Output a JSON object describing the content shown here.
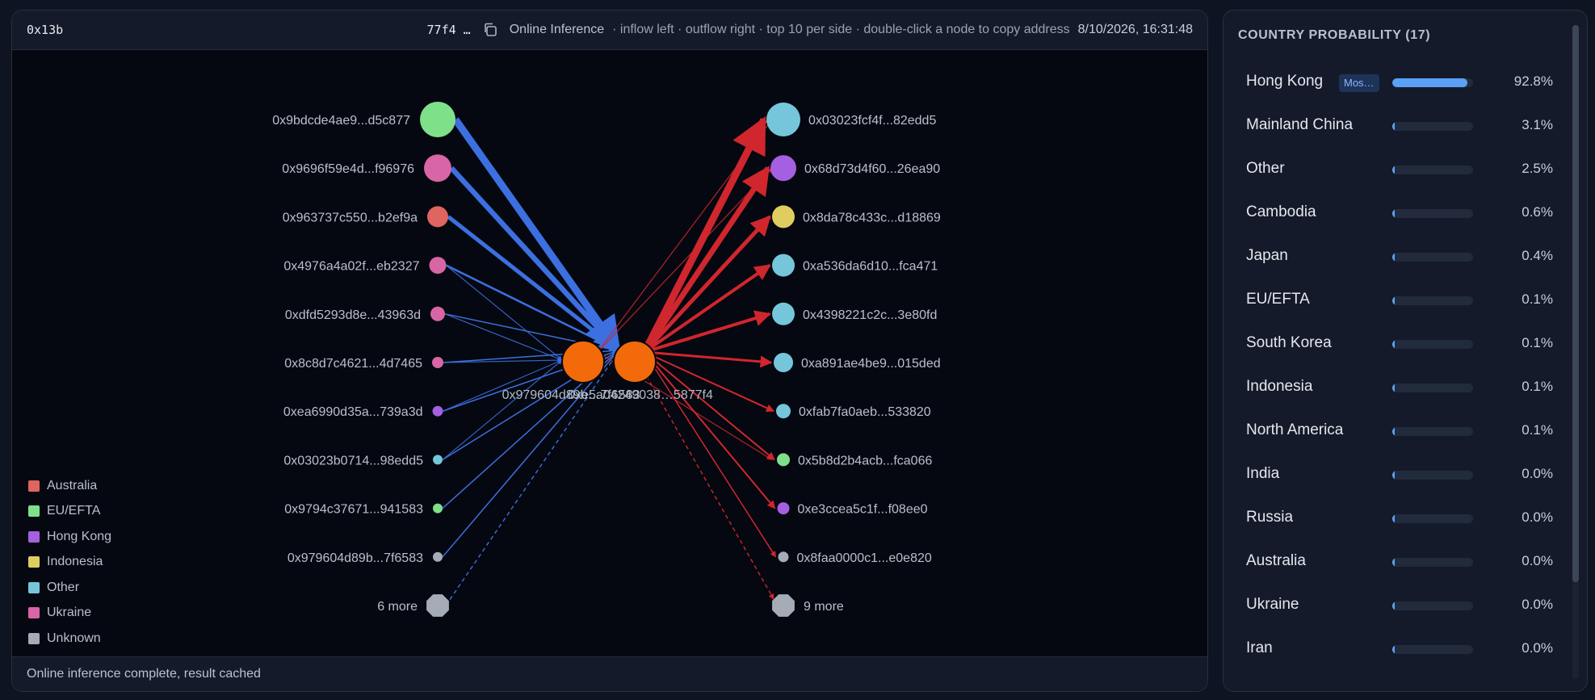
{
  "header": {
    "node_id": "0x13b",
    "address_short": "77f4 …",
    "mode": "Online Inference",
    "hint": "· inflow left · outflow right · top 10 per side · double-click a node to copy address",
    "timestamp": "8/10/2026, 16:31:48"
  },
  "colors": {
    "Australia": "#e0645f",
    "EU/EFTA": "#7fe08a",
    "Hong Kong": "#a460e0",
    "Indonesia": "#e0cd62",
    "Other": "#75c6db",
    "Ukraine": "#d865a6",
    "Unknown": "#a6acb7",
    "center": "#f36a0a",
    "inflow": "#3c6fe0",
    "outflow": "#d0262e"
  },
  "graph": {
    "center_labels": [
      "0x979604d89b…7f6583",
      "0xe5a04249038…5877f4"
    ],
    "inflow": [
      {
        "addr": "0x9bdcde4ae9...d5c877",
        "cat": "EU/EFTA"
      },
      {
        "addr": "0x9696f59e4d...f96976",
        "cat": "Ukraine"
      },
      {
        "addr": "0x963737c550...b2ef9a",
        "cat": "Australia"
      },
      {
        "addr": "0x4976a4a02f...eb2327",
        "cat": "Ukraine"
      },
      {
        "addr": "0xdfd5293d8e...43963d",
        "cat": "Ukraine"
      },
      {
        "addr": "0x8c8d7c4621...4d7465",
        "cat": "Ukraine"
      },
      {
        "addr": "0xea6990d35a...739a3d",
        "cat": "Hong Kong"
      },
      {
        "addr": "0x03023b0714...98edd5",
        "cat": "Other"
      },
      {
        "addr": "0x9794c37671...941583",
        "cat": "EU/EFTA"
      },
      {
        "addr": "0x979604d89b...7f6583",
        "cat": "Unknown"
      }
    ],
    "inflow_more": "6 more",
    "outflow": [
      {
        "addr": "0x03023fcf4f...82edd5",
        "cat": "Other"
      },
      {
        "addr": "0x68d73d4f60...26ea90",
        "cat": "Hong Kong"
      },
      {
        "addr": "0x8da78c433c...d18869",
        "cat": "Indonesia"
      },
      {
        "addr": "0xa536da6d10...fca471",
        "cat": "Other"
      },
      {
        "addr": "0x4398221c2c...3e80fd",
        "cat": "Other"
      },
      {
        "addr": "0xa891ae4be9...015ded",
        "cat": "Other"
      },
      {
        "addr": "0xfab7fa0aeb...533820",
        "cat": "Other"
      },
      {
        "addr": "0x5b8d2b4acb...fca066",
        "cat": "EU/EFTA"
      },
      {
        "addr": "0xe3ccea5c1f...f08ee0",
        "cat": "Hong Kong"
      },
      {
        "addr": "0x8faa0000c1...e0e820",
        "cat": "Unknown"
      }
    ],
    "outflow_more": "9 more"
  },
  "legend": [
    "Australia",
    "EU/EFTA",
    "Hong Kong",
    "Indonesia",
    "Other",
    "Ukraine",
    "Unknown"
  ],
  "status": "Online inference complete, result cached",
  "sidebar": {
    "title": "COUNTRY PROBABILITY (17)",
    "badge": "Mos…",
    "items": [
      {
        "name": "Hong Kong",
        "pct": "92.8%",
        "value": 92.8
      },
      {
        "name": "Mainland China",
        "pct": "3.1%",
        "value": 3.1
      },
      {
        "name": "Other",
        "pct": "2.5%",
        "value": 2.5
      },
      {
        "name": "Cambodia",
        "pct": "0.6%",
        "value": 0.6
      },
      {
        "name": "Japan",
        "pct": "0.4%",
        "value": 0.4
      },
      {
        "name": "EU/EFTA",
        "pct": "0.1%",
        "value": 0.1
      },
      {
        "name": "South Korea",
        "pct": "0.1%",
        "value": 0.1
      },
      {
        "name": "Indonesia",
        "pct": "0.1%",
        "value": 0.1
      },
      {
        "name": "North America",
        "pct": "0.1%",
        "value": 0.1
      },
      {
        "name": "India",
        "pct": "0.0%",
        "value": 0.0
      },
      {
        "name": "Russia",
        "pct": "0.0%",
        "value": 0.0
      },
      {
        "name": "Australia",
        "pct": "0.0%",
        "value": 0.0
      },
      {
        "name": "Ukraine",
        "pct": "0.0%",
        "value": 0.0
      },
      {
        "name": "Iran",
        "pct": "0.0%",
        "value": 0.0
      }
    ]
  }
}
